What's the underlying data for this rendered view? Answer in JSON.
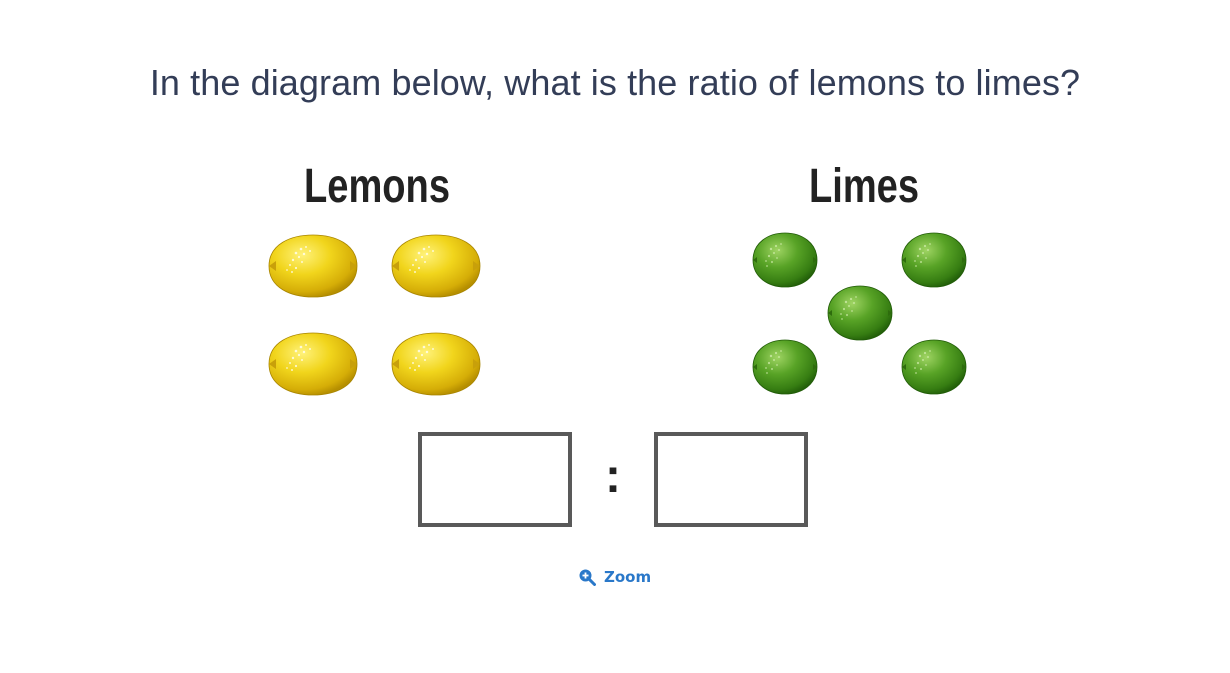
{
  "question": {
    "text": "In the diagram below, what is the ratio of lemons to limes?"
  },
  "diagram": {
    "groups": [
      {
        "label": "Lemons",
        "fruit": "lemon",
        "count": 4,
        "color": "#f1d51c"
      },
      {
        "label": "Limes",
        "fruit": "lime",
        "count": 5,
        "color": "#4f9a1f"
      }
    ],
    "separator": ":",
    "answer_boxes": [
      "",
      ""
    ]
  },
  "zoom": {
    "label": "Zoom",
    "icon": "zoom-in-icon",
    "color": "#2a78c9"
  }
}
